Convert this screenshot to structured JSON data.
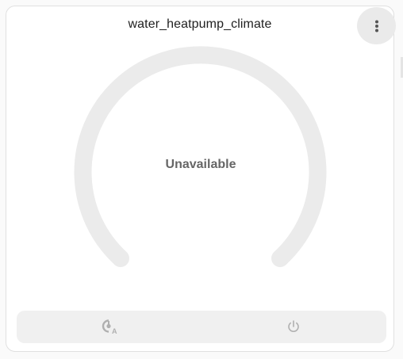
{
  "card": {
    "title": "water_heatpump_climate",
    "status": "Unavailable"
  },
  "icons": {
    "menu": "dots-vertical-icon",
    "auto_mode": "thermostat-auto-icon",
    "power": "power-icon"
  },
  "colors": {
    "dial_track": "#ebebeb",
    "icon_disabled": "#b0b0b0",
    "text_muted": "#666666"
  }
}
